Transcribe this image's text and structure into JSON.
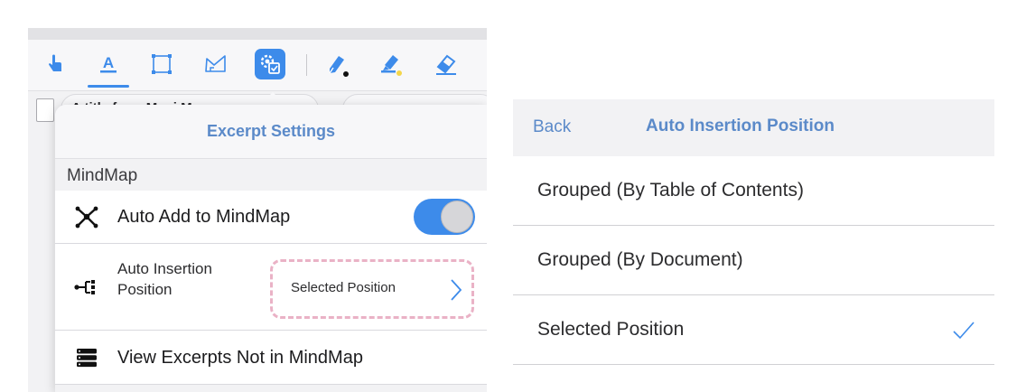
{
  "colors": {
    "accent": "#3d8bea",
    "title_blue": "#5b8ac9",
    "dashed_highlight": "#eab2c6"
  },
  "toolbar": {
    "tools": [
      "hand-pointer-icon",
      "text-highlight-icon",
      "rectangle-select-icon",
      "lasso-icon",
      "excerpt-settings-icon",
      "pen-icon",
      "highlighter-icon",
      "eraser-icon"
    ],
    "active_tool": "excerpt-settings-icon",
    "underlined_tool": "text-highlight-icon"
  },
  "background": {
    "document_tab_text": "A     title from Mm   i    M"
  },
  "excerpt_settings": {
    "title": "Excerpt Settings",
    "section_label": "MindMap",
    "auto_add": {
      "label": "Auto Add to MindMap",
      "enabled": true,
      "icon": "mindmap-node-icon"
    },
    "auto_insertion": {
      "label": "Auto Insertion Position",
      "value": "Selected Position",
      "icon": "insertion-tree-icon"
    },
    "view_excerpts": {
      "label": "View Excerpts Not in MindMap",
      "icon": "stack-list-icon"
    }
  },
  "auto_insertion_position": {
    "back_label": "Back",
    "title": "Auto Insertion Position",
    "options": [
      {
        "label": "Grouped (By Table of Contents)",
        "selected": false
      },
      {
        "label": "Grouped (By Document)",
        "selected": false
      },
      {
        "label": "Selected Position",
        "selected": true
      }
    ]
  }
}
